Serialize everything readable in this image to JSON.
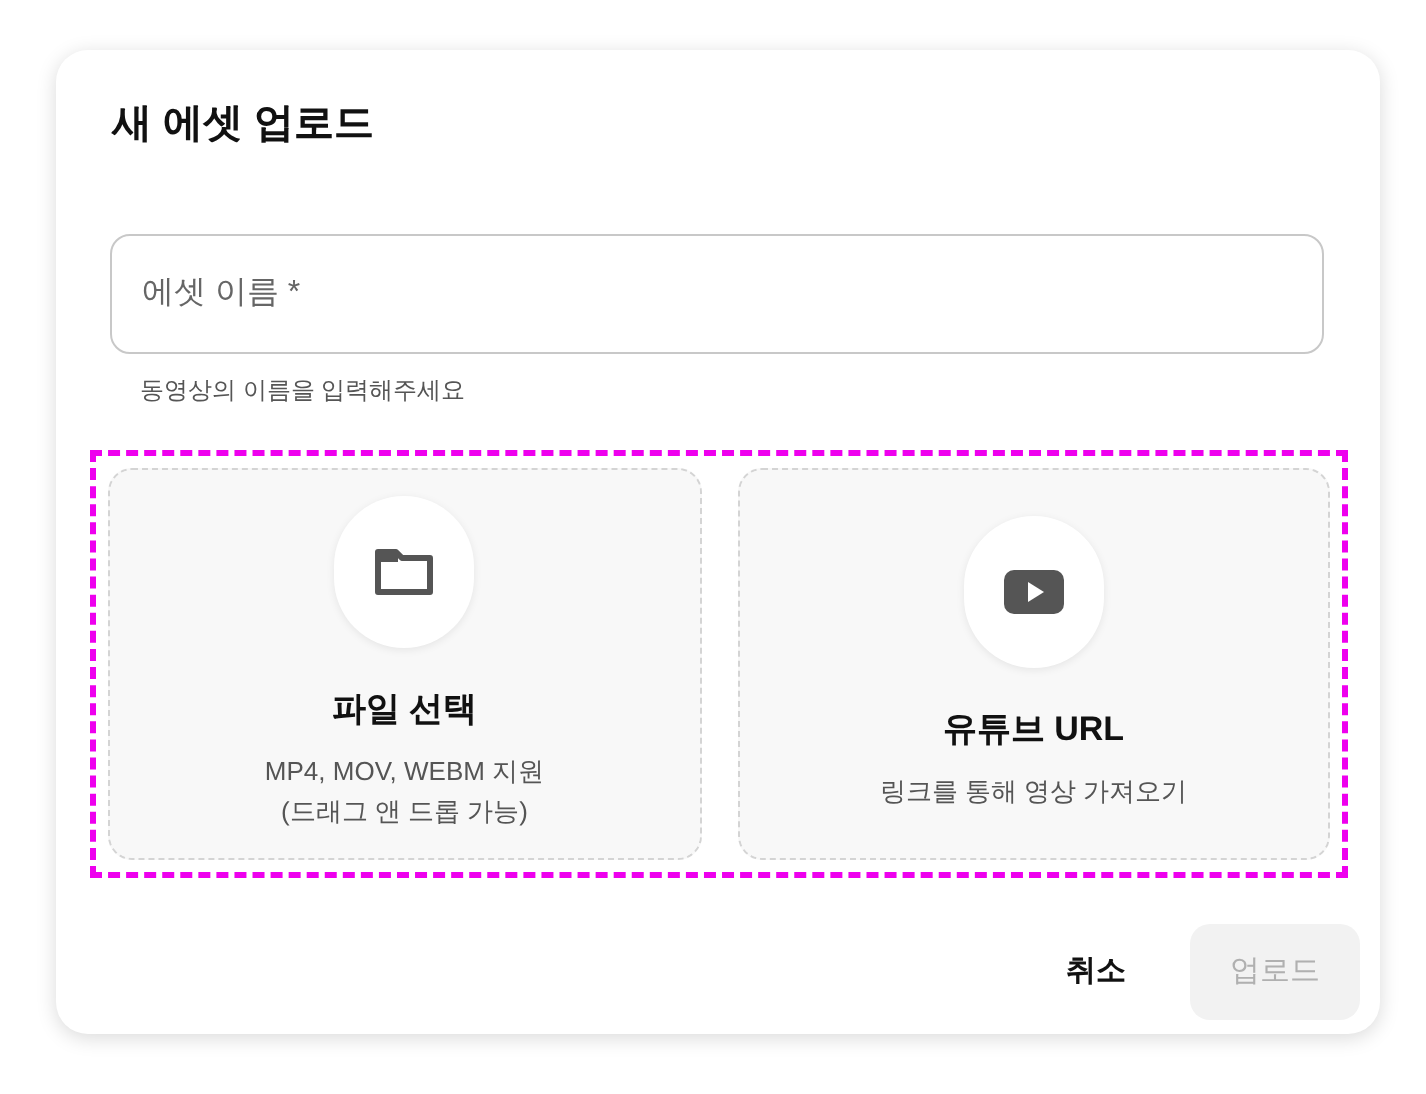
{
  "dialog": {
    "title": "새 에셋 업로드"
  },
  "name_field": {
    "placeholder": "에셋 이름 *",
    "helper": "동영상의 이름을 입력해주세요"
  },
  "sources": [
    {
      "kind": "file",
      "title": "파일 선택",
      "lines": [
        "MP4, MOV, WEBM 지원",
        "(드래그 앤 드롭 가능)"
      ]
    },
    {
      "kind": "youtube",
      "title": "유튜브 URL",
      "lines": [
        "링크를 통해 영상 가져오기"
      ]
    }
  ],
  "buttons": [
    {
      "label": "취소",
      "disabled": false
    },
    {
      "label": "업로드",
      "disabled": true
    }
  ]
}
